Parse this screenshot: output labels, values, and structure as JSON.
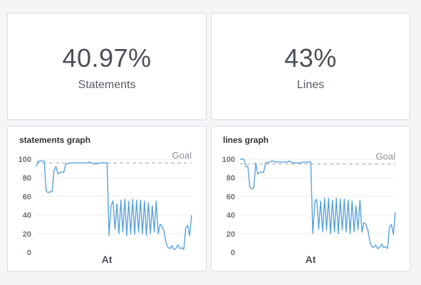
{
  "cards": {
    "statements": {
      "value": "40.97%",
      "label": "Statements"
    },
    "lines": {
      "value": "43%",
      "label": "Lines"
    }
  },
  "colors": {
    "line": "#5aa2dc",
    "goal": "#b5b8bc",
    "grid": "#eceef0"
  },
  "chart_data": [
    {
      "type": "line",
      "title": "statements graph",
      "xlabel": "At",
      "ylabel": "",
      "ylim": [
        0,
        100
      ],
      "yticks": [
        0,
        20,
        40,
        60,
        80,
        100
      ],
      "goal": {
        "label": "Goal",
        "value": 96
      },
      "grid": true,
      "series": [
        {
          "values": [
            92,
            98,
            98,
            98,
            98,
            66,
            64,
            65,
            65,
            88,
            92,
            84,
            86,
            86,
            86,
            95,
            95,
            96,
            96,
            96,
            96,
            96,
            96,
            96,
            96,
            96,
            96,
            97,
            96,
            95,
            95,
            95,
            96,
            96,
            96,
            96,
            96,
            18,
            50,
            55,
            25,
            52,
            20,
            56,
            22,
            57,
            18,
            55,
            20,
            57,
            19,
            56,
            22,
            56,
            20,
            55,
            18,
            53,
            20,
            50,
            22,
            55,
            20,
            30,
            28,
            22,
            10,
            5,
            4,
            7,
            3,
            4,
            8,
            4,
            5,
            3,
            26,
            29,
            18,
            40
          ]
        }
      ]
    },
    {
      "type": "line",
      "title": "lines graph",
      "xlabel": "At",
      "ylabel": "",
      "ylim": [
        0,
        100
      ],
      "yticks": [
        0,
        20,
        40,
        60,
        80,
        100
      ],
      "goal": {
        "label": "Goal",
        "value": 95
      },
      "grid": true,
      "series": [
        {
          "values": [
            100,
            100,
            100,
            92,
            92,
            70,
            68,
            69,
            96,
            84,
            86,
            86,
            86,
            96,
            96,
            97,
            98,
            98,
            97,
            97,
            97,
            97,
            97,
            97,
            97,
            98,
            97,
            96,
            96,
            96,
            96,
            96,
            97,
            97,
            97,
            97,
            97,
            20,
            54,
            57,
            25,
            55,
            22,
            58,
            24,
            58,
            20,
            56,
            22,
            58,
            20,
            57,
            24,
            57,
            22,
            56,
            20,
            55,
            22,
            50,
            24,
            56,
            22,
            32,
            30,
            24,
            12,
            6,
            5,
            8,
            4,
            5,
            9,
            5,
            6,
            4,
            27,
            30,
            19,
            43
          ]
        }
      ]
    }
  ]
}
